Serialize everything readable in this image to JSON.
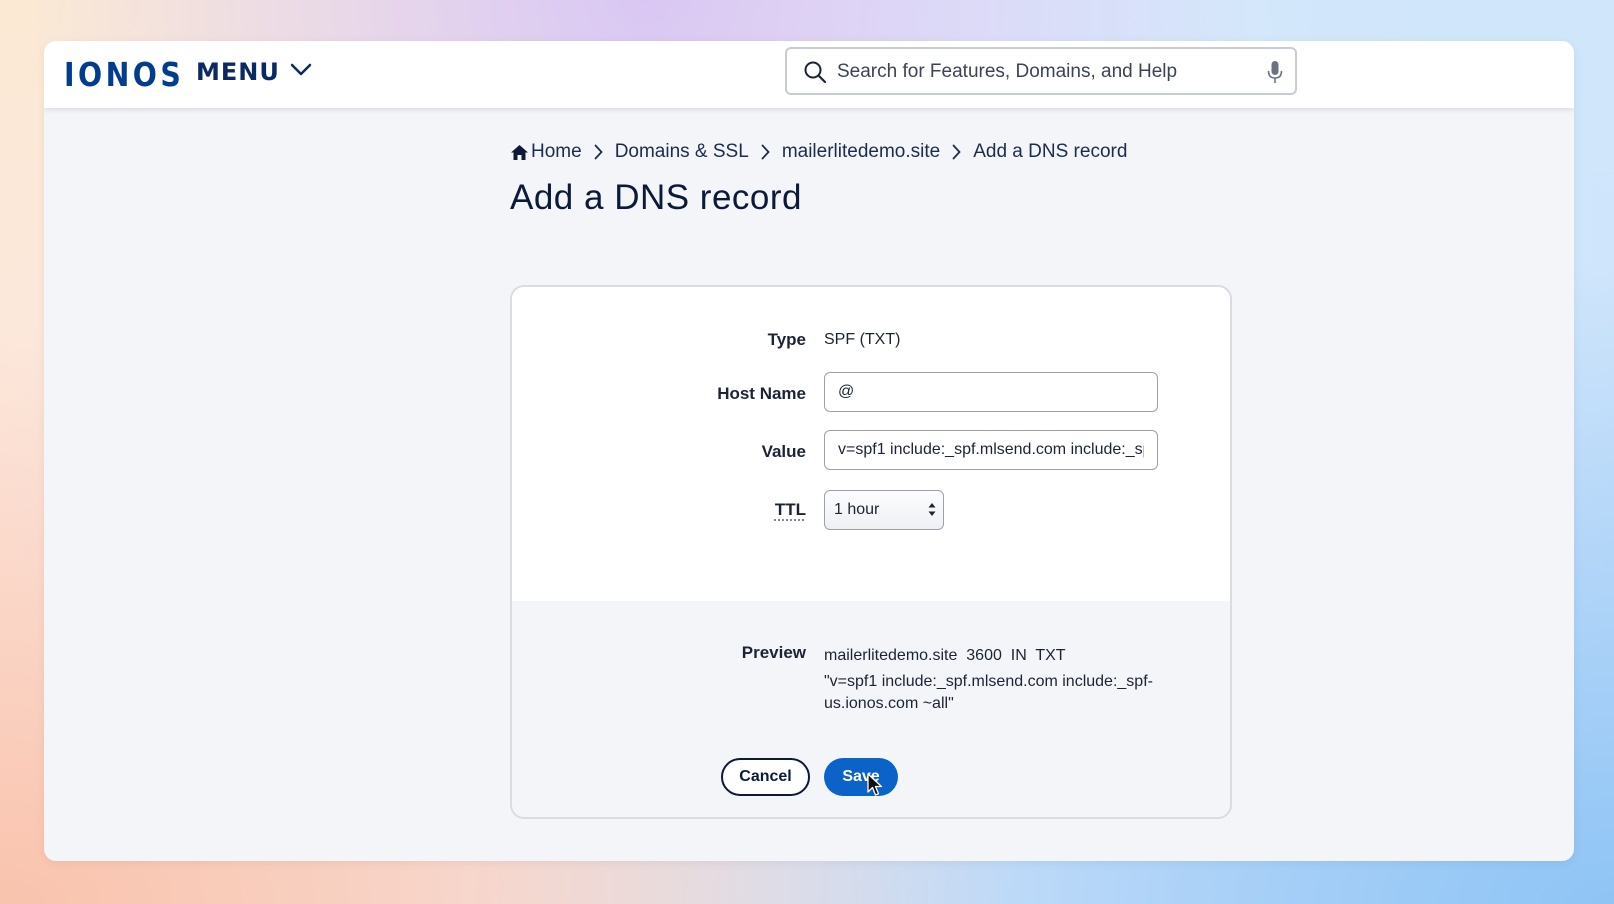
{
  "header": {
    "logo_text": "IONOS",
    "menu_label": "MENU",
    "search_placeholder": "Search for Features, Domains, and Help"
  },
  "breadcrumb": {
    "items": [
      "Home",
      "Domains & SSL",
      "mailerlitedemo.site",
      "Add a DNS record"
    ]
  },
  "page": {
    "title": "Add a DNS record"
  },
  "form": {
    "type_label": "Type",
    "type_value": "SPF (TXT)",
    "host_label": "Host Name",
    "host_value": "@",
    "value_label": "Value",
    "value_value": "v=spf1 include:_spf.mlsend.com include:_spf-us.ionos.com ~all",
    "ttl_label": "TTL",
    "ttl_value": "1 hour",
    "preview_label": "Preview",
    "preview_line1": "mailerlitedemo.site  3600  IN  TXT",
    "preview_line2": "\"v=spf1 include:_spf.mlsend.com include:_spf-us.ionos.com ~all\"",
    "cancel_label": "Cancel",
    "save_label": "Save"
  },
  "colors": {
    "brand": "#003d8f",
    "primary_button": "#0b63c9",
    "text_dark": "#0b1a38"
  },
  "icons": [
    "search-icon",
    "microphone-icon",
    "chevron-down-icon",
    "home-icon",
    "chevron-right-icon",
    "select-arrows-icon",
    "mouse-cursor-icon"
  ]
}
